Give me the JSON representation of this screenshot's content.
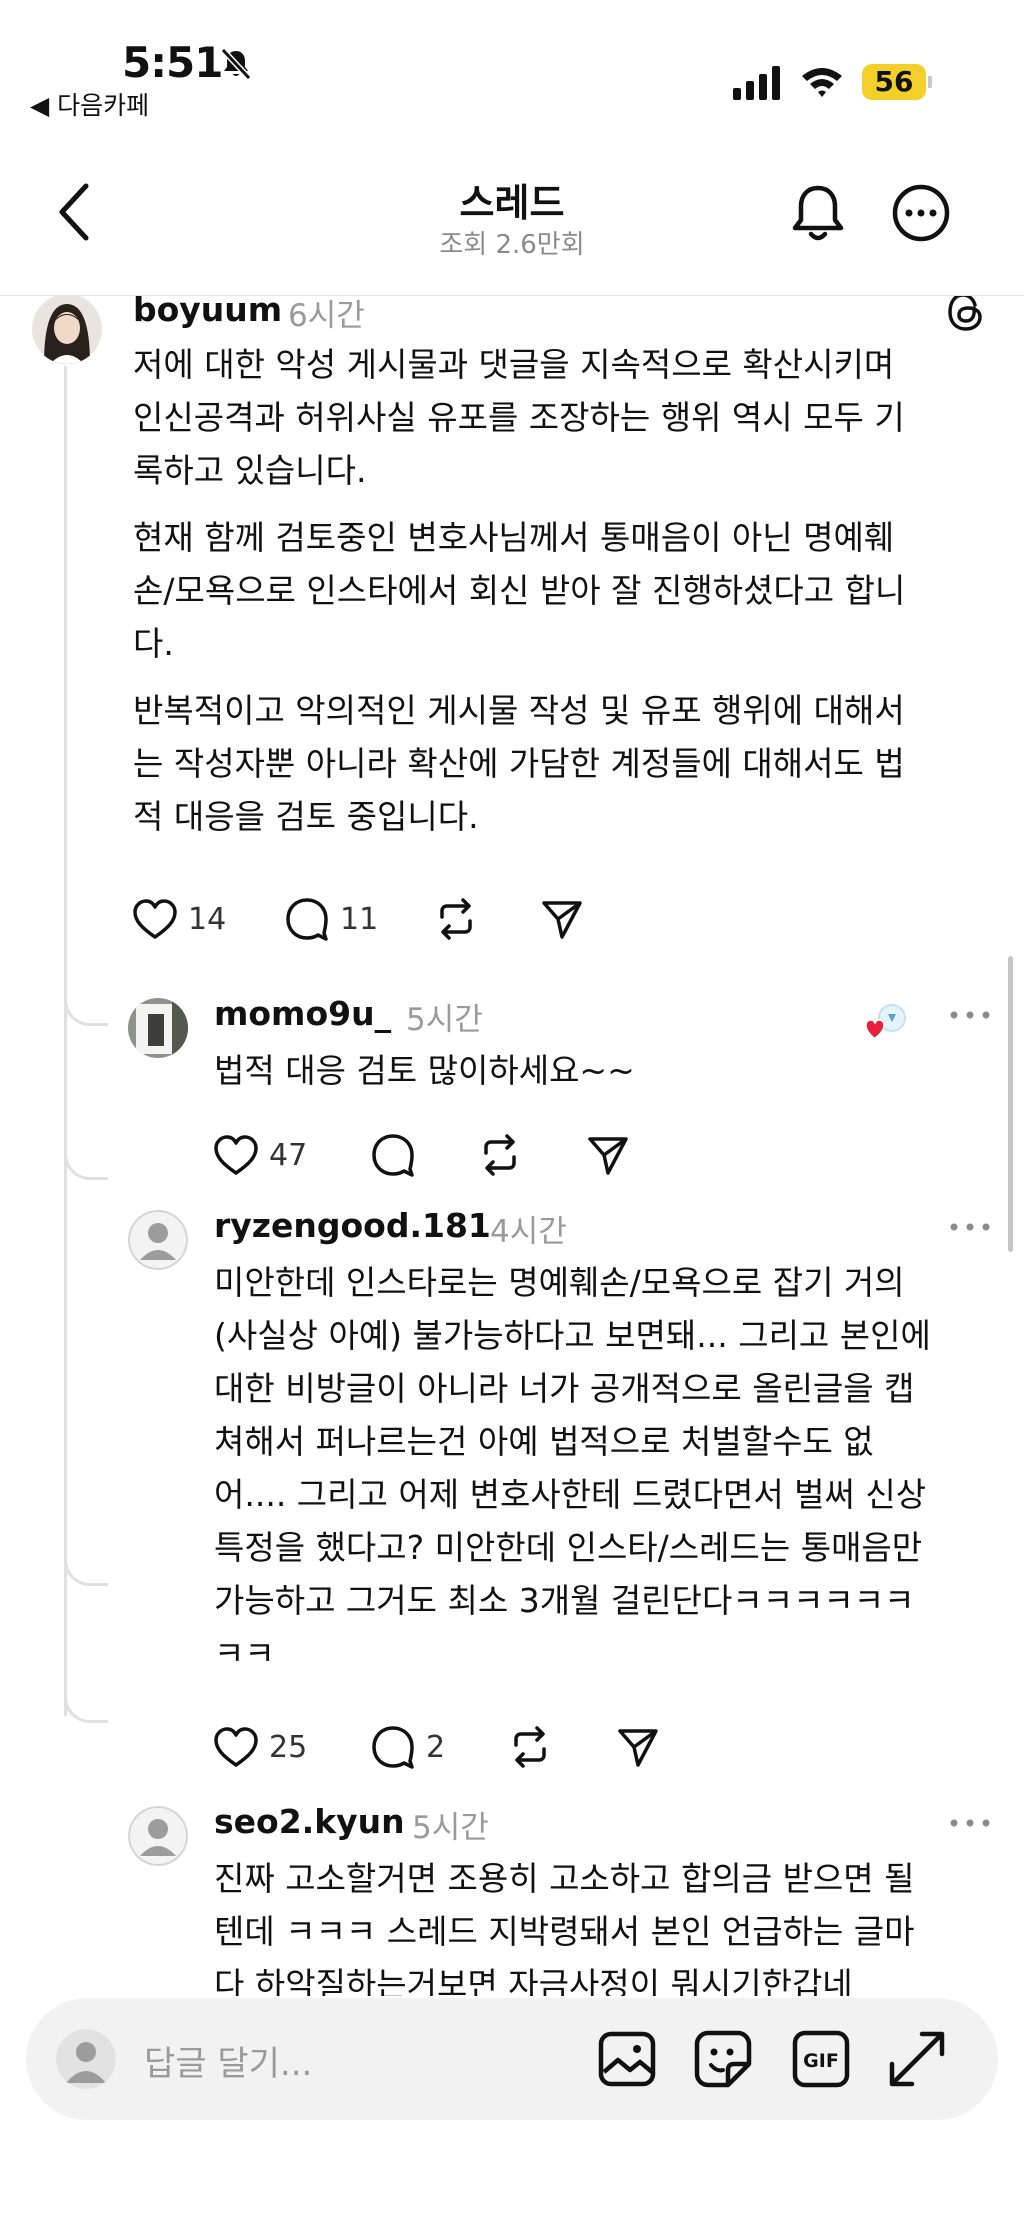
{
  "status_bar": {
    "time": "5:51",
    "back_app": "◀ 다음카페",
    "battery": "56",
    "battery_color": "#f3cf2a"
  },
  "header": {
    "title": "스레드",
    "subtitle": "조회 2.6만회"
  },
  "post": {
    "username": "boyuum",
    "time": "6시간",
    "paragraphs": [
      [
        "저에 대한 악성 게시물과 댓글을 지속적으로 확산시키며",
        "인신공격과 허위사실 유포를 조장하는 행위 역시 모두 기",
        "록하고 있습니다."
      ],
      [
        "현재 함께 검토중인 변호사님께서 통매음이 아닌 명예훼",
        "손/모욕으로 인스타에서 회신 받아 잘 진행하셨다고 합니",
        "다."
      ],
      [
        "반복적이고 악의적인 게시물 작성 및 유포 행위에 대해서",
        "는 작성자뿐 아니라 확산에 가담한 계정들에 대해서도 법",
        "적 대응을 검토 중입니다."
      ]
    ],
    "likes": "14",
    "comments": "11"
  },
  "replies": [
    {
      "username": "momo9u_",
      "time": "5시간",
      "lines": [
        "법적 대응 검토 많이하세요~~"
      ],
      "likes": "47",
      "comments": ""
    },
    {
      "username": "ryzengood.181",
      "time": "4시간",
      "lines": [
        "미안한데 인스타로는 명예훼손/모욕으로 잡기 거의",
        "(사실상 아예) 불가능하다고 보면돼... 그리고 본인에",
        "대한 비방글이 아니라 너가 공개적으로 올린글을 캡",
        "쳐해서 퍼나르는건 아예 법적으로 처벌할수도 없",
        "어.... 그리고 어제 변호사한테 드렸다면서 벌써 신상",
        "특정을 했다고? 미안한데 인스타/스레드는 통매음만",
        "가능하고 그거도 최소 3개월 걸린단다ㅋㅋㅋㅋㅋㅋ",
        "ㅋㅋ"
      ],
      "likes": "25",
      "comments": "2"
    },
    {
      "username": "seo2.kyun",
      "time": "5시간",
      "lines": [
        "진짜 고소할거면 조용히 고소하고 합의금 받으면 될",
        "텐데 ㅋㅋㅋ 스레드 지박령돼서 본인 언급하는 글마",
        "다 하악질하는거보면 자금사정이 뭐시기한갑네"
      ],
      "likes": "",
      "comments": ""
    }
  ],
  "composer": {
    "placeholder": "답글 달기...",
    "icons": [
      "image-icon",
      "sticker-icon",
      "gif-icon",
      "expand-icon"
    ]
  }
}
